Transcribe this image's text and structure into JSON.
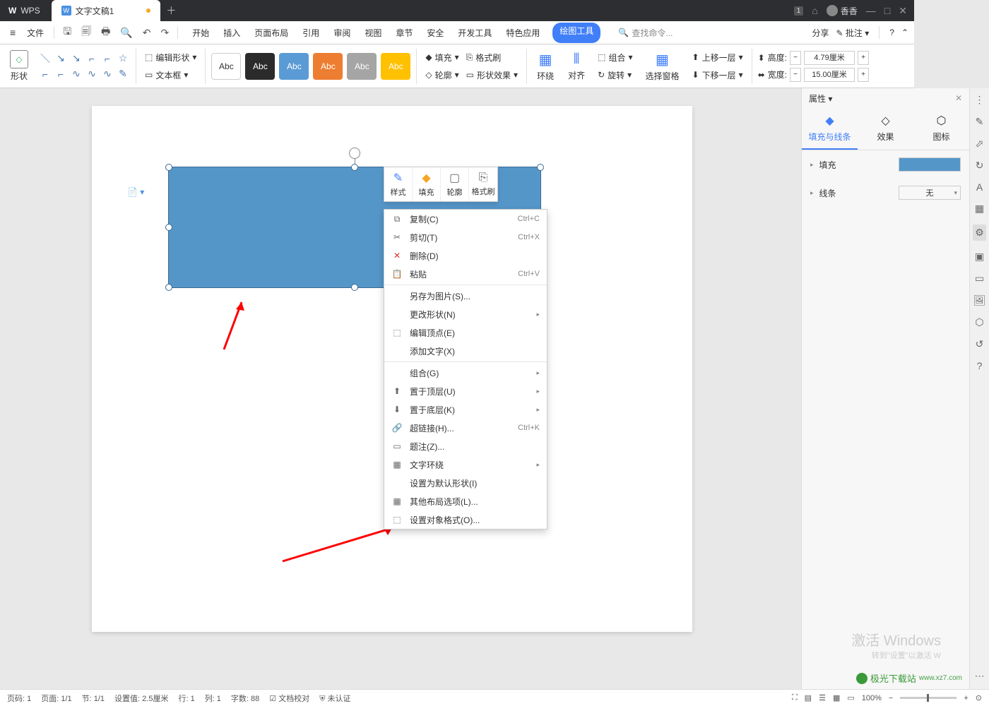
{
  "titlebar": {
    "app": "WPS",
    "tab_title": "文字文稿1",
    "user_name": "香香"
  },
  "menubar": {
    "file": "文件",
    "tabs": [
      "开始",
      "插入",
      "页面布局",
      "引用",
      "审阅",
      "视图",
      "章节",
      "安全",
      "开发工具",
      "特色应用"
    ],
    "active": "绘图工具",
    "search_placeholder": "查找命令...",
    "share": "分享",
    "annotate": "批注"
  },
  "ribbon": {
    "shape": "形状",
    "edit_shape": "编辑形状",
    "text_box": "文本框",
    "abc": "Abc",
    "fill": "填充",
    "outline": "轮廓",
    "format_brush": "格式刷",
    "shape_effect": "形状效果",
    "wrap": "环绕",
    "align": "对齐",
    "group": "组合",
    "rotate": "旋转",
    "select_pane": "选择窗格",
    "move_up": "上移一层",
    "move_down": "下移一层",
    "height_label": "高度:",
    "width_label": "宽度:",
    "height_val": "4.79厘米",
    "width_val": "15.00厘米"
  },
  "float_toolbar": {
    "style": "样式",
    "fill": "填充",
    "outline": "轮廓",
    "format_brush": "格式刷"
  },
  "context_menu": {
    "items": [
      {
        "icon": "⧉",
        "label": "复制(C)",
        "shortcut": "Ctrl+C"
      },
      {
        "icon": "✂",
        "label": "剪切(T)",
        "shortcut": "Ctrl+X"
      },
      {
        "icon": "✕",
        "label": "删除(D)",
        "shortcut": "",
        "red": true
      },
      {
        "icon": "📋",
        "label": "粘贴",
        "shortcut": "Ctrl+V"
      },
      {
        "sep": true
      },
      {
        "icon": "",
        "label": "另存为图片(S)...",
        "shortcut": ""
      },
      {
        "icon": "",
        "label": "更改形状(N)",
        "shortcut": "",
        "arrow": true
      },
      {
        "icon": "⬚",
        "label": "编辑顶点(E)",
        "shortcut": ""
      },
      {
        "icon": "",
        "label": "添加文字(X)",
        "shortcut": ""
      },
      {
        "sep": true
      },
      {
        "icon": "",
        "label": "组合(G)",
        "shortcut": "",
        "arrow": true
      },
      {
        "icon": "⬆",
        "label": "置于顶层(U)",
        "shortcut": "",
        "arrow": true
      },
      {
        "icon": "⬇",
        "label": "置于底层(K)",
        "shortcut": "",
        "arrow": true
      },
      {
        "icon": "🔗",
        "label": "超链接(H)...",
        "shortcut": "Ctrl+K"
      },
      {
        "icon": "▭",
        "label": "题注(Z)...",
        "shortcut": ""
      },
      {
        "icon": "▦",
        "label": "文字环绕",
        "shortcut": "",
        "arrow": true
      },
      {
        "icon": "",
        "label": "设置为默认形状(I)",
        "shortcut": ""
      },
      {
        "icon": "▦",
        "label": "其他布局选项(L)...",
        "shortcut": ""
      },
      {
        "icon": "⬚",
        "label": "设置对象格式(O)...",
        "shortcut": ""
      }
    ]
  },
  "props": {
    "title": "属性",
    "tab1": "填充与线条",
    "tab2": "效果",
    "tab3": "图标",
    "fill": "填充",
    "line": "线条",
    "line_value": "无"
  },
  "status": {
    "page_code": "页码: 1",
    "page": "页面: 1/1",
    "section": "节: 1/1",
    "setting": "设置值: 2.5厘米",
    "row": "行: 1",
    "col": "列: 1",
    "words": "字数: 88",
    "proof": "文档校对",
    "unauth": "未认证",
    "zoom": "100%"
  },
  "watermark": {
    "l1": "激活 Windows",
    "l2": "转到\"设置\"以激活 W"
  },
  "sitemark": {
    "name": "极光下载站",
    "url": "www.xz7.com"
  }
}
